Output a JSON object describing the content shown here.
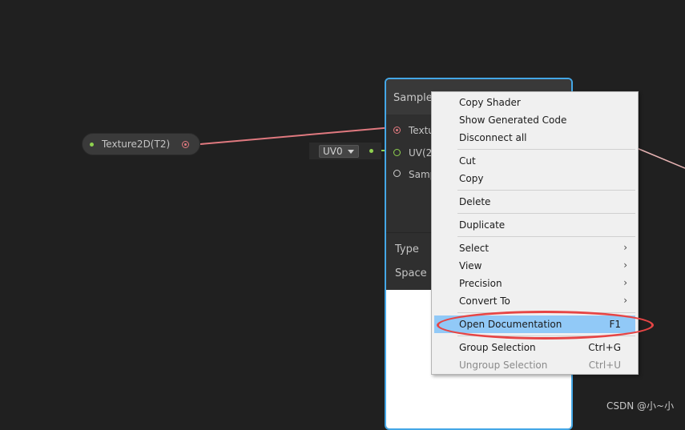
{
  "property_node": {
    "label": "Texture2D(T2)"
  },
  "uv_input": {
    "value": "UV0"
  },
  "sample_node": {
    "title": "Sample",
    "ports": [
      "Textu",
      "UV(2",
      "Samp"
    ],
    "type_label": "Type",
    "space_label": "Space"
  },
  "context_menu": {
    "items": [
      {
        "label": "Copy Shader"
      },
      {
        "label": "Show Generated Code"
      },
      {
        "label": "Disconnect all"
      },
      {
        "label": "Cut"
      },
      {
        "label": "Copy"
      },
      {
        "label": "Delete"
      },
      {
        "label": "Duplicate"
      },
      {
        "label": "Select",
        "submenu": true
      },
      {
        "label": "View",
        "submenu": true
      },
      {
        "label": "Precision",
        "submenu": true
      },
      {
        "label": "Convert To",
        "submenu": true
      },
      {
        "label": "Open Documentation",
        "shortcut": "F1",
        "highlighted": true
      },
      {
        "label": "Group Selection",
        "shortcut": "Ctrl+G"
      },
      {
        "label": "Ungroup Selection",
        "shortcut": "Ctrl+U",
        "disabled": true
      }
    ],
    "submenu_arrow": "›"
  },
  "watermark": "CSDN @小~小",
  "colors": {
    "background": "#202020",
    "node_selected_border": "#44a7e6",
    "wire_texture": "#e0797f",
    "wire_uv": "#8fd14f",
    "menu_highlight": "#91c9f7",
    "annotation": "#e64545"
  }
}
